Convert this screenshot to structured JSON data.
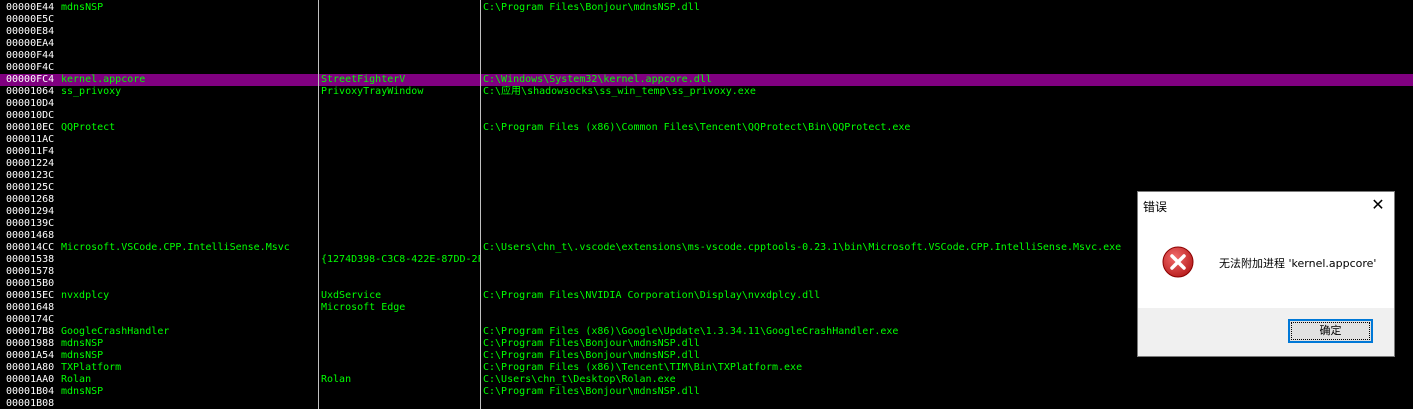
{
  "rows": [
    {
      "pid": "00000E44",
      "name": "mdnsNSP",
      "window": "",
      "path": "C:\\Program Files\\Bonjour\\mdnsNSP.dll"
    },
    {
      "pid": "00000E5C",
      "name": "",
      "window": "",
      "path": ""
    },
    {
      "pid": "00000E84",
      "name": "",
      "window": "",
      "path": ""
    },
    {
      "pid": "00000EA4",
      "name": "",
      "window": "",
      "path": ""
    },
    {
      "pid": "00000F44",
      "name": "",
      "window": "",
      "path": ""
    },
    {
      "pid": "00000F4C",
      "name": "",
      "window": "",
      "path": ""
    },
    {
      "pid": "00000FC4",
      "name": "kernel.appcore",
      "window": "StreetFighterV",
      "path": "C:\\Windows\\System32\\kernel.appcore.dll",
      "selected": true
    },
    {
      "pid": "00001064",
      "name": "ss_privoxy",
      "window": "PrivoxyTrayWindow",
      "path": "C:\\应用\\shadowsocks\\ss_win_temp\\ss_privoxy.exe"
    },
    {
      "pid": "000010D4",
      "name": "",
      "window": "",
      "path": ""
    },
    {
      "pid": "000010DC",
      "name": "",
      "window": "",
      "path": ""
    },
    {
      "pid": "000010EC",
      "name": "QQProtect",
      "window": "",
      "path": "C:\\Program Files (x86)\\Common Files\\Tencent\\QQProtect\\Bin\\QQProtect.exe"
    },
    {
      "pid": "000011AC",
      "name": "",
      "window": "",
      "path": ""
    },
    {
      "pid": "000011F4",
      "name": "",
      "window": "",
      "path": ""
    },
    {
      "pid": "00001224",
      "name": "",
      "window": "",
      "path": ""
    },
    {
      "pid": "0000123C",
      "name": "",
      "window": "",
      "path": ""
    },
    {
      "pid": "0000125C",
      "name": "",
      "window": "",
      "path": ""
    },
    {
      "pid": "00001268",
      "name": "",
      "window": "",
      "path": ""
    },
    {
      "pid": "00001294",
      "name": "",
      "window": "",
      "path": ""
    },
    {
      "pid": "0000139C",
      "name": "",
      "window": "",
      "path": ""
    },
    {
      "pid": "00001468",
      "name": "",
      "window": "",
      "path": ""
    },
    {
      "pid": "000014CC",
      "name": "Microsoft.VSCode.CPP.IntelliSense.Msvc",
      "window": "",
      "path": "C:\\Users\\chn_t\\.vscode\\extensions\\ms-vscode.cpptools-0.23.1\\bin\\Microsoft.VSCode.CPP.IntelliSense.Msvc.exe"
    },
    {
      "pid": "00001538",
      "name": "",
      "window": "{1274D398-C3C8-422E-87DD-2F",
      "path": ""
    },
    {
      "pid": "00001578",
      "name": "",
      "window": "",
      "path": ""
    },
    {
      "pid": "000015B0",
      "name": "",
      "window": "",
      "path": ""
    },
    {
      "pid": "000015EC",
      "name": "nvxdplcy",
      "window": "UxdService",
      "path": "C:\\Program Files\\NVIDIA Corporation\\Display\\nvxdplcy.dll"
    },
    {
      "pid": "00001648",
      "name": "",
      "window": "Microsoft Edge",
      "path": ""
    },
    {
      "pid": "0000174C",
      "name": "",
      "window": "",
      "path": ""
    },
    {
      "pid": "000017B8",
      "name": "GoogleCrashHandler",
      "window": "",
      "path": "C:\\Program Files (x86)\\Google\\Update\\1.3.34.11\\GoogleCrashHandler.exe"
    },
    {
      "pid": "00001988",
      "name": "mdnsNSP",
      "window": "",
      "path": "C:\\Program Files\\Bonjour\\mdnsNSP.dll"
    },
    {
      "pid": "00001A54",
      "name": "mdnsNSP",
      "window": "",
      "path": "C:\\Program Files\\Bonjour\\mdnsNSP.dll"
    },
    {
      "pid": "00001A80",
      "name": "TXPlatform",
      "window": "",
      "path": "C:\\Program Files (x86)\\Tencent\\TIM\\Bin\\TXPlatform.exe"
    },
    {
      "pid": "00001AA0",
      "name": "Rolan",
      "window": "Rolan",
      "path": "C:\\Users\\chn_t\\Desktop\\Rolan.exe"
    },
    {
      "pid": "00001B04",
      "name": "mdnsNSP",
      "window": "",
      "path": "C:\\Program Files\\Bonjour\\mdnsNSP.dll"
    },
    {
      "pid": "00001B08",
      "name": "",
      "window": "",
      "path": ""
    }
  ],
  "dialog": {
    "title": "错误",
    "message": "无法附加进程 'kernel.appcore'",
    "ok_label": "确定",
    "icon": "error-icon",
    "close_icon": "close-icon"
  },
  "colors": {
    "background": "#000000",
    "text": "#00ff00",
    "pid_text": "#ffffff",
    "selected_row": "#800080",
    "error_icon": "#d32f2f"
  }
}
